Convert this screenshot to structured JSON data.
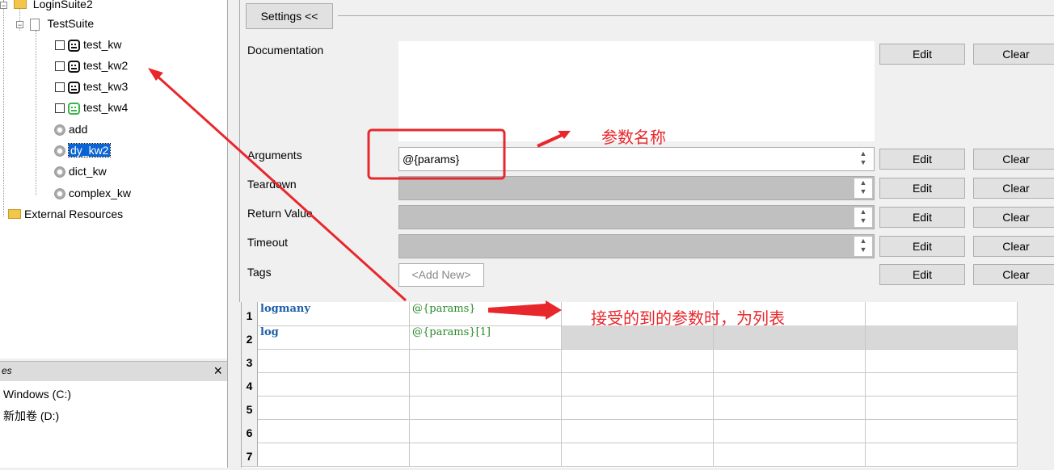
{
  "tree": {
    "root_label": "LoginSuite2",
    "suite_label": "TestSuite",
    "keywords": [
      {
        "label": "test_kw",
        "icon": "keyword-icon"
      },
      {
        "label": "test_kw2",
        "icon": "keyword-icon"
      },
      {
        "label": "test_kw3",
        "icon": "keyword-icon"
      },
      {
        "label": "test_kw4",
        "icon": "keyword-icon-green"
      }
    ],
    "user_keywords": [
      {
        "label": "add"
      },
      {
        "label": "dy_kw2",
        "selected": true
      },
      {
        "label": "dict_kw"
      },
      {
        "label": "complex_kw"
      }
    ],
    "external_label": "External Resources"
  },
  "drives": {
    "header_label": "es",
    "close_label": "×",
    "items": [
      "Windows (C:)",
      "新加卷 (D:)"
    ]
  },
  "settings": {
    "toggle_label": "Settings <<",
    "rows": [
      {
        "label": "Documentation",
        "value": "",
        "edit": "Edit",
        "clear": "Clear"
      },
      {
        "label": "Arguments",
        "value": "@{params}",
        "edit": "Edit",
        "clear": "Clear"
      },
      {
        "label": "Teardown",
        "value": "",
        "edit": "Edit",
        "clear": "Clear"
      },
      {
        "label": "Return Value",
        "value": "",
        "edit": "Edit",
        "clear": "Clear"
      },
      {
        "label": "Timeout",
        "value": "",
        "edit": "Edit",
        "clear": "Clear"
      },
      {
        "label": "Tags",
        "value": "",
        "edit": "Edit",
        "clear": "Clear"
      }
    ],
    "tags_placeholder": "<Add New>"
  },
  "grid": {
    "rows": [
      {
        "num": "1",
        "keyword": "logmany",
        "arg1": "@{params}"
      },
      {
        "num": "2",
        "keyword": "log",
        "arg1": "@{params}[1]"
      },
      {
        "num": "3",
        "keyword": "",
        "arg1": ""
      },
      {
        "num": "4",
        "keyword": "",
        "arg1": ""
      },
      {
        "num": "5",
        "keyword": "",
        "arg1": ""
      },
      {
        "num": "6",
        "keyword": "",
        "arg1": ""
      },
      {
        "num": "7",
        "keyword": "",
        "arg1": ""
      }
    ]
  },
  "annotations": {
    "param_name": "参数名称",
    "param_list": "接受的到的参数时，为列表"
  },
  "colors": {
    "annotation": "#e8272c",
    "selection": "#0a64d6",
    "keyword_text": "#1e5fa8",
    "argument_text": "#2a8a2a"
  }
}
